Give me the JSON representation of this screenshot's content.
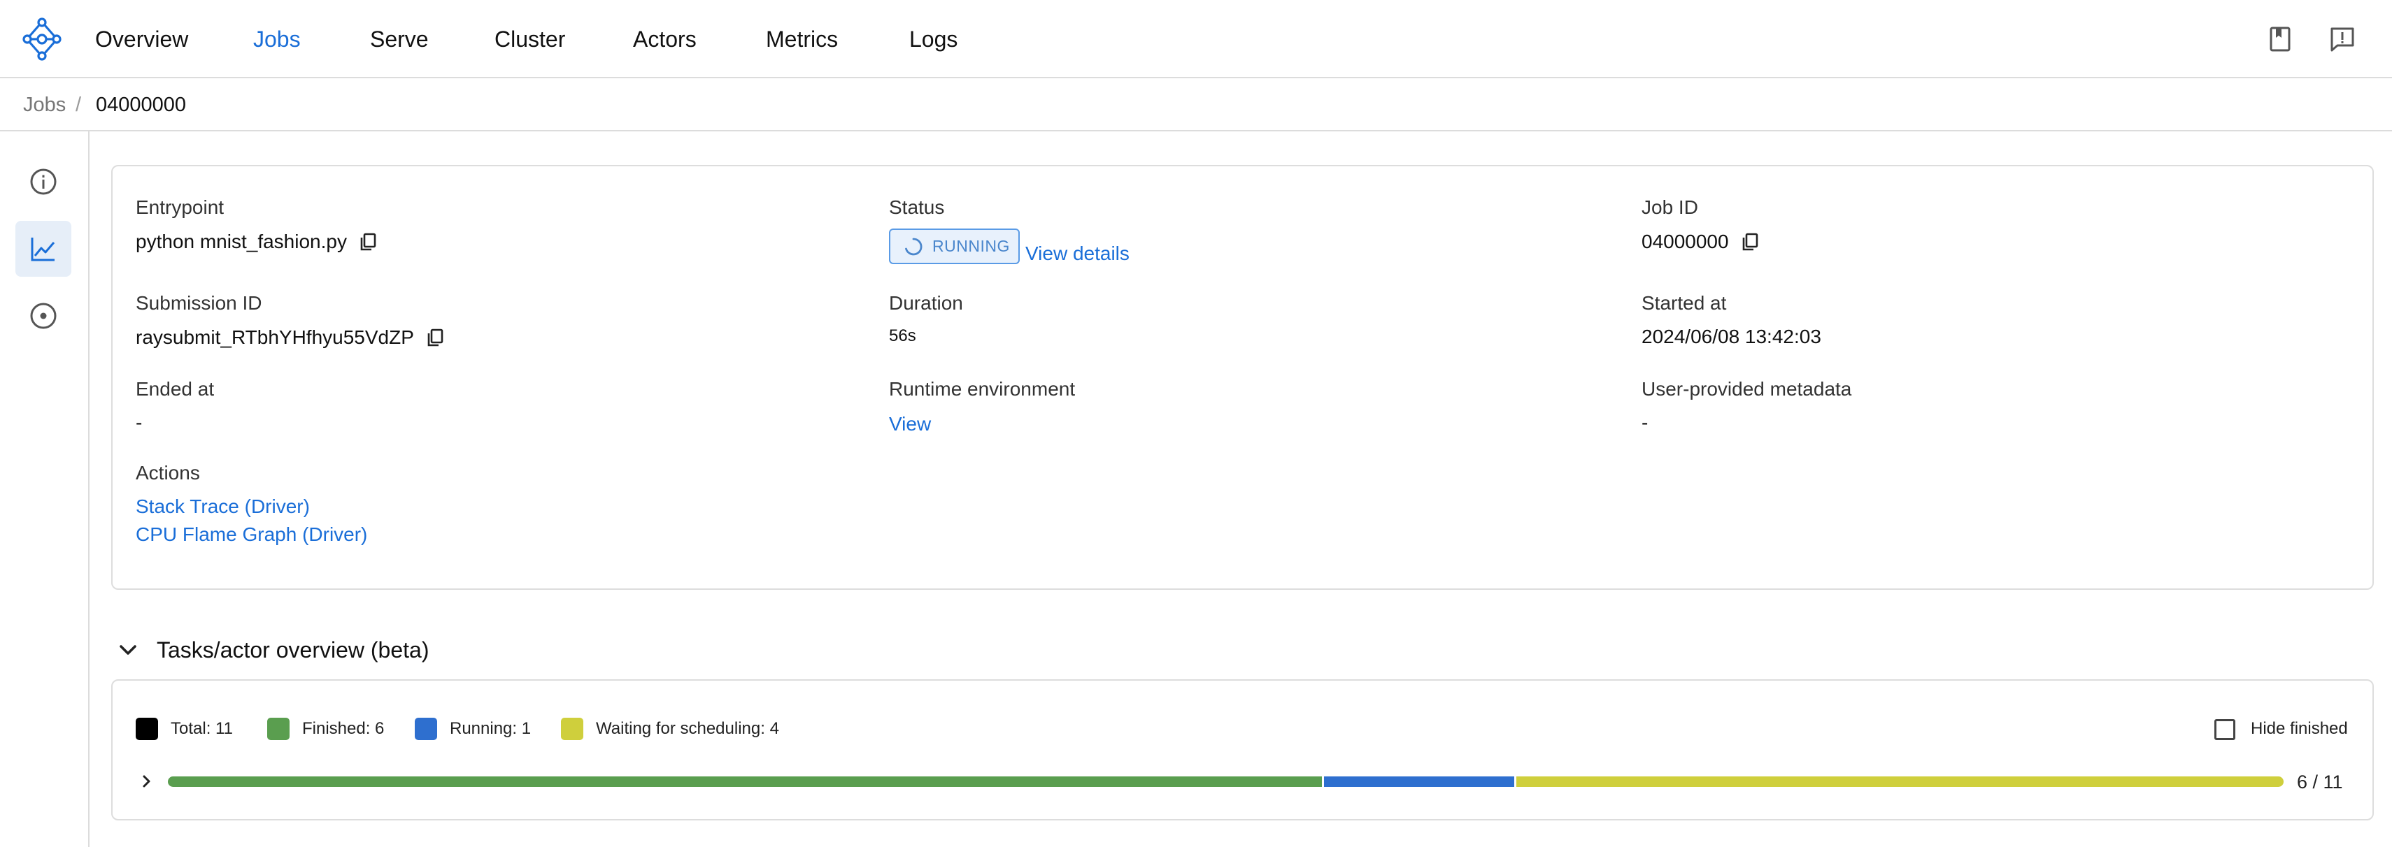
{
  "nav": {
    "items": [
      {
        "label": "Overview",
        "active": false
      },
      {
        "label": "Jobs",
        "active": true
      },
      {
        "label": "Serve",
        "active": false
      },
      {
        "label": "Cluster",
        "active": false
      },
      {
        "label": "Actors",
        "active": false
      },
      {
        "label": "Metrics",
        "active": false
      },
      {
        "label": "Logs",
        "active": false
      }
    ],
    "right_icons": [
      "docs-book-icon",
      "feedback-icon"
    ]
  },
  "breadcrumb": {
    "parent": "Jobs",
    "separator": "/",
    "current": "04000000"
  },
  "rail": {
    "icons": [
      "info-icon",
      "chart-line-icon",
      "target-icon"
    ],
    "active_index": 1
  },
  "job": {
    "entrypoint": {
      "label": "Entrypoint",
      "value": "python mnist_fashion.py"
    },
    "status": {
      "label": "Status",
      "value": "RUNNING",
      "details_link": "View details"
    },
    "job_id": {
      "label": "Job ID",
      "value": "04000000"
    },
    "submission_id": {
      "label": "Submission ID",
      "value": "raysubmit_RTbhYHfhyu55VdZP"
    },
    "duration": {
      "label": "Duration",
      "value": "56s"
    },
    "started_at": {
      "label": "Started at",
      "value": "2024/06/08 13:42:03"
    },
    "ended_at": {
      "label": "Ended at",
      "value": "-"
    },
    "runtime_env": {
      "label": "Runtime environment",
      "value": "View"
    },
    "metadata": {
      "label": "User-provided metadata",
      "value": "-"
    },
    "actions": {
      "label": "Actions",
      "links": [
        "Stack Trace (Driver)",
        "CPU Flame Graph (Driver)"
      ]
    }
  },
  "tasks_overview": {
    "title": "Tasks/actor overview (beta)",
    "legend": [
      {
        "label": "Total: 11",
        "color": "#000000"
      },
      {
        "label": "Finished: 6",
        "color": "#5a9e4f"
      },
      {
        "label": "Running: 1",
        "color": "#2e6fcf"
      },
      {
        "label": "Waiting for scheduling: 4",
        "color": "#cfcf3c"
      }
    ],
    "hide_finished_label": "Hide finished",
    "hide_finished_checked": false,
    "progress": {
      "total": 11,
      "segments": [
        {
          "name": "finished",
          "count": 6,
          "color": "#5a9e4f"
        },
        {
          "name": "running",
          "count": 1,
          "color": "#2e6fcf"
        },
        {
          "name": "waiting",
          "count": 4,
          "color": "#cfcf3c"
        }
      ],
      "count_text": "6 / 11"
    }
  }
}
